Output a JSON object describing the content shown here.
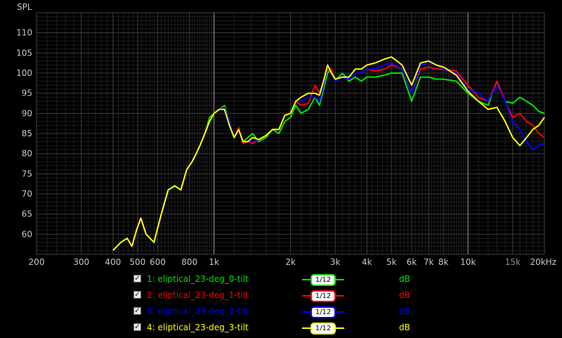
{
  "chart_data": {
    "type": "line",
    "ylabel": "SPL",
    "xscale": "log",
    "xlim": [
      200,
      20000
    ],
    "ylim": [
      55,
      115
    ],
    "x_ticks": [
      {
        "v": 200,
        "label": "200",
        "major": true
      },
      {
        "v": 300,
        "label": "300",
        "major": true
      },
      {
        "v": 400,
        "label": "400",
        "major": true
      },
      {
        "v": 500,
        "label": "500",
        "major": true
      },
      {
        "v": 600,
        "label": "600",
        "major": true
      },
      {
        "v": 800,
        "label": "800",
        "major": true
      },
      {
        "v": 1000,
        "label": "1k",
        "major": true
      },
      {
        "v": 2000,
        "label": "2k",
        "major": true
      },
      {
        "v": 3000,
        "label": "3k",
        "major": true
      },
      {
        "v": 4000,
        "label": "4k",
        "major": true
      },
      {
        "v": 5000,
        "label": "5k",
        "major": true
      },
      {
        "v": 6000,
        "label": "6k",
        "major": true
      },
      {
        "v": 7000,
        "label": "7k",
        "major": true
      },
      {
        "v": 8000,
        "label": "8k",
        "major": true
      },
      {
        "v": 10000,
        "label": "10k",
        "major": true
      },
      {
        "v": 15000,
        "label": "15k",
        "major": false
      },
      {
        "v": 20000,
        "label": "20kHz",
        "major": true
      }
    ],
    "y_ticks": [
      60,
      65,
      70,
      75,
      80,
      85,
      90,
      95,
      100,
      105,
      110
    ],
    "grid": true,
    "series": [
      {
        "name": "1: eliptical_23-deg_0-tilt",
        "color": "#00e400",
        "x": [
          400,
          430,
          455,
          475,
          495,
          515,
          540,
          580,
          620,
          660,
          700,
          740,
          780,
          820,
          850,
          880,
          920,
          960,
          1000,
          1050,
          1100,
          1150,
          1200,
          1250,
          1300,
          1360,
          1420,
          1500,
          1600,
          1700,
          1800,
          1900,
          2000,
          2100,
          2200,
          2350,
          2500,
          2600,
          2700,
          2800,
          2900,
          3000,
          3200,
          3400,
          3600,
          3800,
          4000,
          4300,
          4700,
          5000,
          5500,
          6000,
          6500,
          7000,
          7500,
          8000,
          9000,
          10000,
          11000,
          12000,
          13000,
          14000,
          15000,
          16000,
          17000,
          18000,
          19000,
          20000
        ],
        "y": [
          56,
          58,
          59,
          57,
          61,
          64,
          60,
          58,
          65,
          71,
          72,
          71,
          76,
          78,
          80,
          82,
          85,
          89,
          90,
          91,
          92,
          88,
          84,
          86,
          83,
          84,
          85,
          83,
          84,
          86,
          85,
          88,
          89,
          92,
          90,
          91,
          94,
          92,
          96,
          100,
          101,
          98,
          100,
          98,
          99,
          98,
          99,
          99,
          99.5,
          100,
          100,
          93,
          99,
          99,
          98.5,
          98.5,
          98,
          95,
          93,
          92,
          98,
          93,
          92.5,
          94,
          93,
          92,
          90.5,
          90
        ]
      },
      {
        "name": "2: eliptical_23-deg_1-tilt",
        "color": "#ff0000",
        "x": [
          400,
          430,
          455,
          475,
          495,
          515,
          540,
          580,
          620,
          660,
          700,
          740,
          780,
          820,
          850,
          880,
          920,
          960,
          1000,
          1050,
          1100,
          1150,
          1200,
          1250,
          1300,
          1360,
          1420,
          1500,
          1600,
          1700,
          1800,
          1900,
          2000,
          2100,
          2200,
          2350,
          2500,
          2600,
          2700,
          2800,
          2900,
          3000,
          3200,
          3400,
          3600,
          3800,
          4000,
          4300,
          4700,
          5000,
          5500,
          6000,
          6500,
          7000,
          7500,
          8000,
          9000,
          10000,
          11000,
          12000,
          13000,
          14000,
          15000,
          16000,
          17000,
          18000,
          19000,
          20000
        ],
        "y": [
          56,
          58,
          59,
          57,
          61,
          64,
          60,
          58,
          65,
          71,
          72,
          71,
          76,
          78,
          80,
          82,
          85,
          88,
          90,
          91,
          91.5,
          88,
          84,
          86.5,
          82.5,
          83,
          82.5,
          83.5,
          84.5,
          86,
          86,
          89.5,
          90,
          93,
          92,
          92.5,
          97,
          95,
          98,
          101,
          101,
          98,
          99,
          98.5,
          100,
          100,
          101,
          100.5,
          101,
          102,
          101,
          95,
          101,
          101.5,
          101,
          101,
          100.5,
          97,
          94,
          93,
          98,
          93,
          89,
          90,
          88,
          87,
          85,
          84
        ]
      },
      {
        "name": "3: eliptical_23-deg_2-tilt",
        "color": "#0000ff",
        "x": [
          400,
          430,
          455,
          475,
          495,
          515,
          540,
          580,
          620,
          660,
          700,
          740,
          780,
          820,
          850,
          880,
          920,
          960,
          1000,
          1050,
          1100,
          1150,
          1200,
          1250,
          1300,
          1360,
          1420,
          1500,
          1600,
          1700,
          1800,
          1900,
          2000,
          2100,
          2200,
          2350,
          2500,
          2600,
          2700,
          2800,
          2900,
          3000,
          3200,
          3400,
          3600,
          3800,
          4000,
          4300,
          4700,
          5000,
          5500,
          6000,
          6500,
          7000,
          7500,
          8000,
          9000,
          10000,
          11000,
          12000,
          13000,
          14000,
          15000,
          16000,
          17000,
          18000,
          19000,
          20000
        ],
        "y": [
          56,
          58,
          59,
          57,
          61,
          64,
          60,
          58,
          65,
          71,
          72,
          71,
          76,
          78,
          80,
          82,
          85,
          88,
          90,
          91,
          91.5,
          88,
          84,
          86,
          83,
          83,
          83,
          83.5,
          84.5,
          86,
          86,
          89.5,
          90,
          93,
          93,
          94,
          94,
          93,
          97,
          102,
          100,
          98,
          99,
          98.5,
          100,
          100,
          101,
          101,
          102,
          102.5,
          101,
          95,
          102,
          102.5,
          102,
          101,
          100,
          96,
          95,
          93,
          97,
          93,
          88,
          86,
          83,
          81,
          82,
          82.5
        ]
      },
      {
        "name": "4: eliptical_23-deg_3-tilt",
        "color": "#ffff00",
        "x": [
          400,
          430,
          455,
          475,
          495,
          515,
          540,
          580,
          620,
          660,
          700,
          740,
          780,
          820,
          850,
          880,
          920,
          960,
          1000,
          1050,
          1100,
          1150,
          1200,
          1250,
          1300,
          1360,
          1420,
          1500,
          1600,
          1700,
          1800,
          1900,
          2000,
          2100,
          2200,
          2350,
          2500,
          2600,
          2700,
          2800,
          2900,
          3000,
          3200,
          3400,
          3600,
          3800,
          4000,
          4300,
          4700,
          5000,
          5500,
          6000,
          6500,
          7000,
          7500,
          8000,
          9000,
          10000,
          11000,
          12000,
          13000,
          14000,
          15000,
          16000,
          17000,
          18000,
          19000,
          20000
        ],
        "y": [
          56,
          58,
          59,
          57,
          61,
          64,
          60,
          58,
          65,
          71,
          72,
          71,
          76,
          78,
          80,
          82,
          85,
          88,
          90,
          91,
          91,
          87,
          84,
          86,
          83,
          83,
          84,
          83.5,
          84.5,
          86,
          86,
          89.5,
          90,
          93,
          94,
          95,
          95,
          94.5,
          98,
          102,
          100,
          98.5,
          99,
          99,
          101,
          101,
          102,
          102.5,
          103.5,
          104,
          102,
          97,
          102.5,
          103,
          102,
          101.5,
          99.5,
          95.5,
          93,
          91,
          91.5,
          88,
          84,
          82,
          84,
          86,
          87,
          89
        ]
      }
    ]
  },
  "legend": {
    "items": [
      {
        "label": "1: eliptical_23-deg_0-tilt",
        "color": "#00e400",
        "check": "✓",
        "smoothing": "1/12",
        "unit": "dB"
      },
      {
        "label": "2: eliptical_23-deg_1-tilt",
        "color": "#ff0000",
        "check": "✓",
        "smoothing": "1/12",
        "unit": "dB"
      },
      {
        "label": "3: eliptical_23-deg_2-tilt",
        "color": "#0000ff",
        "check": "✓",
        "smoothing": "1/12",
        "unit": "dB"
      },
      {
        "label": "4: eliptical_23-deg_3-tilt",
        "color": "#ffff00",
        "check": "✓",
        "smoothing": "1/12",
        "unit": "dB"
      }
    ]
  }
}
